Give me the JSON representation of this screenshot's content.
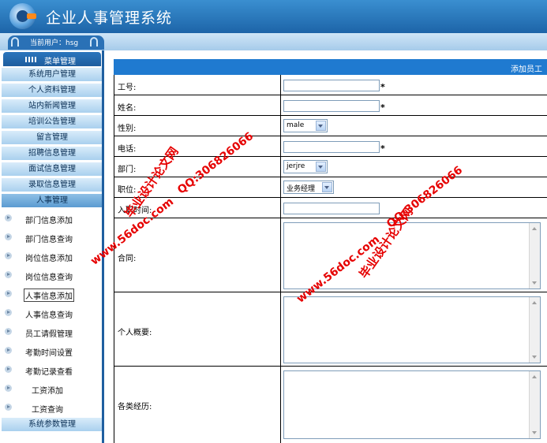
{
  "header": {
    "title": "企业人事管理系统",
    "current_user": "当前用户：hsg"
  },
  "sidebar": {
    "menu_title": "菜单管理",
    "top_items": [
      "系统用户管理",
      "个人资料管理",
      "站内新闻管理",
      "培训公告管理",
      "留言管理",
      "招聘信息管理",
      "面试信息管理",
      "录取信息管理",
      "人事管理"
    ],
    "sub_items": [
      "部门信息添加",
      "部门信息查询",
      "岗位信息添加",
      "岗位信息查询",
      "人事信息添加",
      "人事信息查询",
      "员工请假管理",
      "考勤时间设置",
      "考勤记录查看",
      "工资添加",
      "工资查询"
    ],
    "bottom_item": "系统参数管理"
  },
  "form": {
    "title": "添加员工",
    "fields": {
      "employee_no": {
        "label": "工号:",
        "value": "",
        "required": "*"
      },
      "name": {
        "label": "姓名:",
        "value": "",
        "required": "*"
      },
      "gender": {
        "label": "性别:",
        "value": "male"
      },
      "phone": {
        "label": "电话:",
        "value": "",
        "required": "*"
      },
      "department": {
        "label": "部门:",
        "value": "jerjre"
      },
      "position": {
        "label": "职位:",
        "value": "业务经理"
      },
      "entry_time": {
        "label": "入职时间:",
        "value": ""
      },
      "contract": {
        "label": "合同:",
        "value": ""
      },
      "profile": {
        "label": "个人概要:",
        "value": ""
      },
      "experience": {
        "label": "各类经历:",
        "value": ""
      }
    }
  },
  "watermarks": {
    "site": "www.56doc.com",
    "qq": "QQ:306826066",
    "name": "毕业设计论文网"
  }
}
